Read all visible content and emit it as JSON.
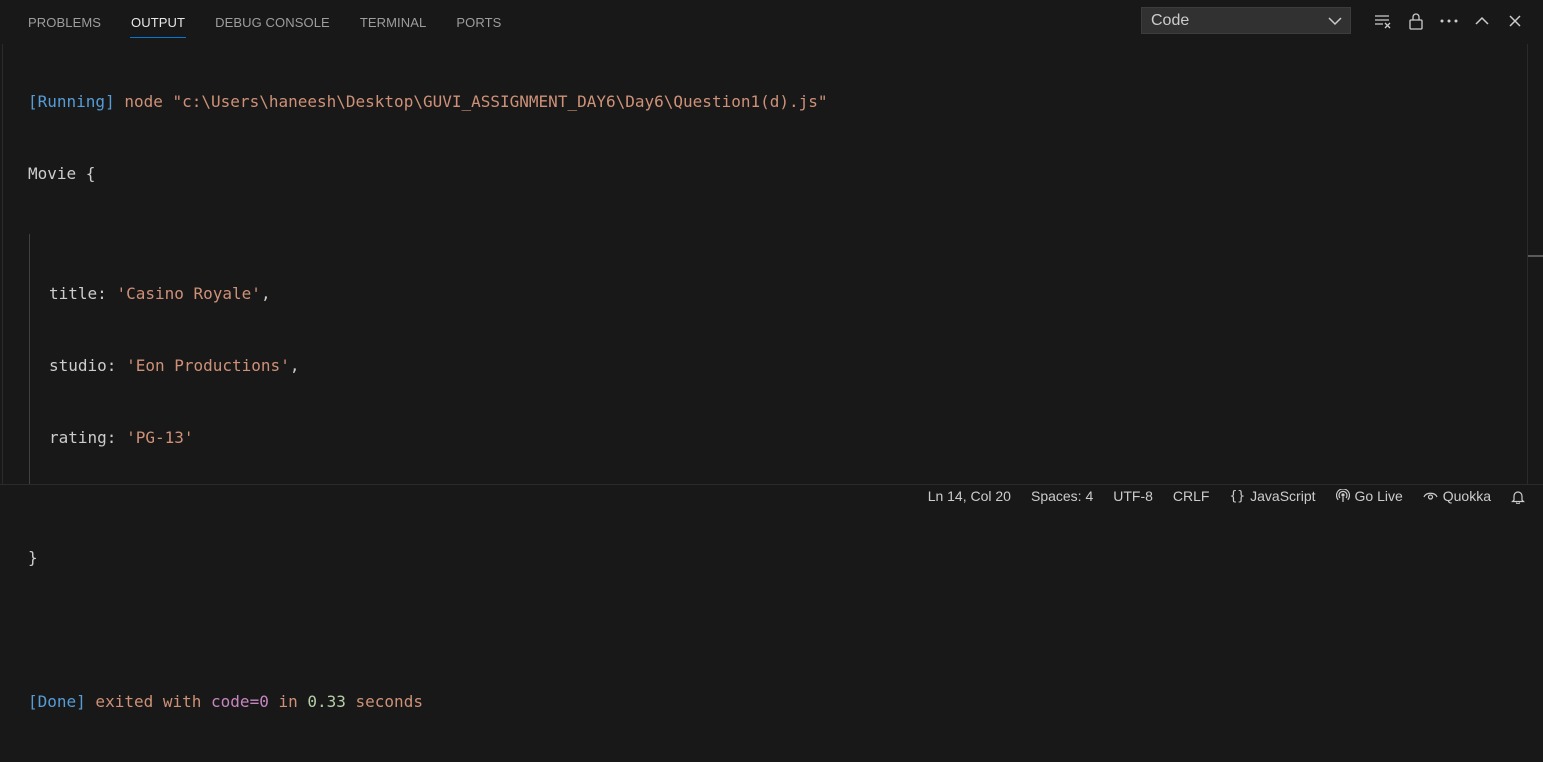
{
  "tabs": [
    {
      "label": "PROBLEMS",
      "active": false
    },
    {
      "label": "OUTPUT",
      "active": true
    },
    {
      "label": "DEBUG CONSOLE",
      "active": false
    },
    {
      "label": "TERMINAL",
      "active": false
    },
    {
      "label": "PORTS",
      "active": false
    }
  ],
  "output_channel": {
    "selected": "Code"
  },
  "toolbar_icons": [
    "clear-output-icon",
    "lock-icon",
    "more-actions-icon",
    "maximize-panel-icon",
    "close-panel-icon"
  ],
  "output": {
    "running_tag": "[Running]",
    "running_cmd": " node \"c:\\Users\\haneesh\\Desktop\\GUVI_ASSIGNMENT_DAY6\\Day6\\Question1(d).js\"",
    "object_open": "Movie {",
    "fields": [
      {
        "key": "title: ",
        "value": "'Casino Royale'",
        "suffix": ","
      },
      {
        "key": "studio: ",
        "value": "'Eon Productions'",
        "suffix": ","
      },
      {
        "key": "rating: ",
        "value": "'PG-13'",
        "suffix": ""
      }
    ],
    "object_close": "}",
    "done_tag": "[Done]",
    "done_exited": " exited with ",
    "done_code": "code=0",
    "done_in": " in ",
    "done_time": "0.33",
    "done_seconds": " seconds"
  },
  "status_bar": {
    "position": "Ln 14, Col 20",
    "spaces": "Spaces: 4",
    "encoding": "UTF-8",
    "eol": "CRLF",
    "language": "JavaScript",
    "go_live": "Go Live",
    "quokka": "Quokka"
  },
  "colors": {
    "background": "#181818",
    "accent": "#0078d4",
    "running_tag": "#569cd6",
    "string": "#ce9178",
    "number": "#b5cea8",
    "keyword": "#c586c0"
  }
}
